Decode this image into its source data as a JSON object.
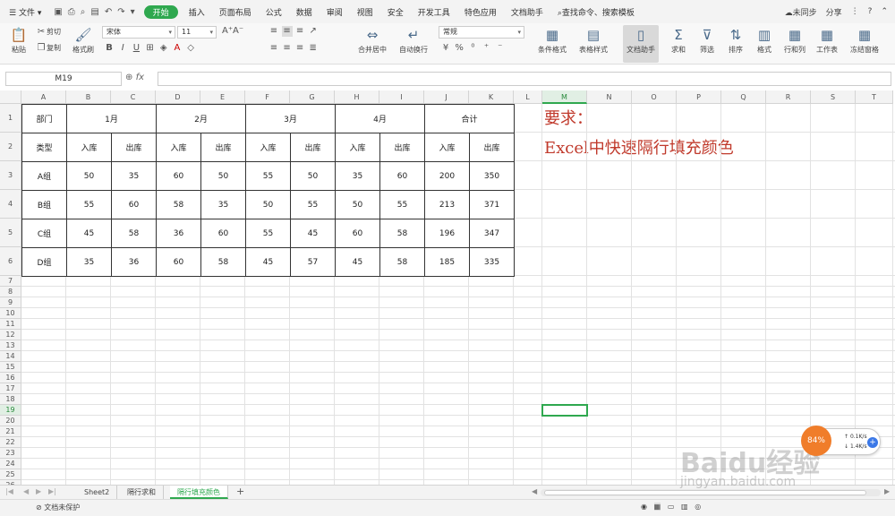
{
  "menu": {
    "file_label": "文件",
    "tabs": [
      "开始",
      "插入",
      "页面布局",
      "公式",
      "数据",
      "审阅",
      "视图",
      "安全",
      "开发工具",
      "特色应用",
      "文档助手"
    ],
    "search_placeholder": "查找命令、搜索模板",
    "sync_label": "未同步",
    "share_label": "分享"
  },
  "ribbon": {
    "paste": "粘贴",
    "cut": "剪切",
    "copy": "复制",
    "format_painter": "格式刷",
    "font_name": "宋体",
    "font_size": "11",
    "number_format": "常规",
    "merge_center": "合并居中",
    "wrap_text": "自动换行",
    "conditional_format": "条件格式",
    "table_style": "表格样式",
    "doc_assistant": "文档助手",
    "sum": "求和",
    "filter": "筛选",
    "sort": "排序",
    "format": "格式",
    "row_col": "行和列",
    "worksheet": "工作表",
    "freeze": "冻结窗格"
  },
  "formula_bar": {
    "name_box": "M19",
    "fx_label": "fx",
    "formula": ""
  },
  "grid": {
    "columns": [
      "A",
      "B",
      "C",
      "D",
      "E",
      "F",
      "G",
      "H",
      "I",
      "J",
      "K",
      "L",
      "M",
      "N",
      "O",
      "P",
      "Q",
      "R",
      "S",
      "T"
    ],
    "rows": [
      "1",
      "2",
      "3",
      "4",
      "5",
      "6",
      "7",
      "8",
      "9",
      "10",
      "11",
      "12",
      "13",
      "14",
      "15",
      "16",
      "17",
      "18",
      "19",
      "20",
      "21",
      "22",
      "23",
      "24",
      "25",
      "26"
    ],
    "active_column": "M",
    "active_row": "19"
  },
  "table": {
    "header1": [
      "部门",
      "1月",
      "2月",
      "3月",
      "4月",
      "合计"
    ],
    "header2": [
      "类型",
      "入库",
      "出库",
      "入库",
      "出库",
      "入库",
      "出库",
      "入库",
      "出库",
      "入库",
      "出库"
    ],
    "rows": [
      [
        "A组",
        "50",
        "35",
        "60",
        "50",
        "55",
        "50",
        "35",
        "60",
        "200",
        "350"
      ],
      [
        "B组",
        "55",
        "60",
        "58",
        "35",
        "50",
        "55",
        "50",
        "55",
        "213",
        "371"
      ],
      [
        "C组",
        "45",
        "58",
        "36",
        "60",
        "55",
        "45",
        "60",
        "58",
        "196",
        "347"
      ],
      [
        "D组",
        "35",
        "36",
        "60",
        "58",
        "45",
        "57",
        "45",
        "58",
        "185",
        "335"
      ]
    ]
  },
  "notes": {
    "line1": "要求：",
    "line2": "Excel中快速隔行填充颜色"
  },
  "sheets": [
    "Sheet2",
    "隔行求和",
    "隔行填充颜色"
  ],
  "active_sheet": "隔行填充颜色",
  "status": {
    "protect": "文档未保护"
  },
  "widget": {
    "percent": "84%",
    "up_speed": "0.1K/s",
    "down_speed": "1.4K/s"
  },
  "watermark": {
    "brand": "Baidu经验",
    "url": "jingyan.baidu.com"
  }
}
